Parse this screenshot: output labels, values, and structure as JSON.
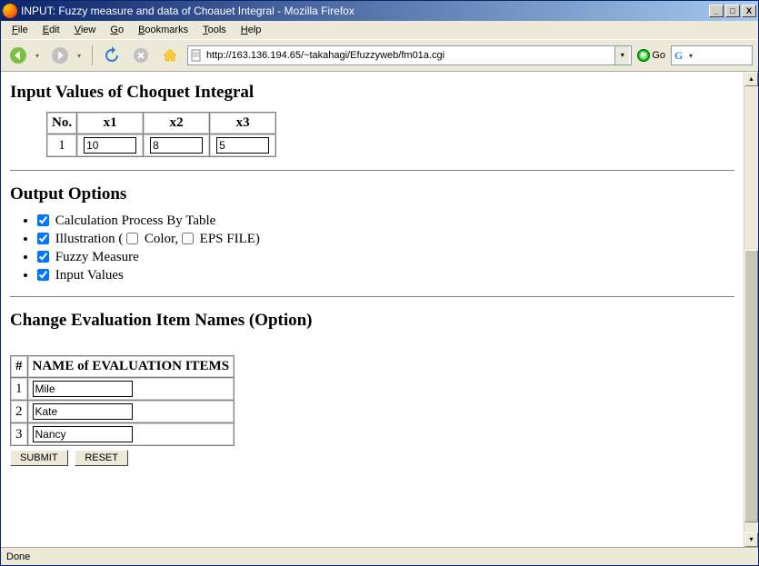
{
  "window": {
    "title": "INPUT: Fuzzy measure and data of Choauet Integral - Mozilla Firefox"
  },
  "menubar": {
    "file": "File",
    "edit": "Edit",
    "view": "View",
    "go": "Go",
    "bookmarks": "Bookmarks",
    "tools": "Tools",
    "help": "Help"
  },
  "toolbar": {
    "url": "http://163.136.194.65/~takahagi/Efuzzyweb/fm01a.cgi",
    "go_label": "Go"
  },
  "page": {
    "section1_heading": "Input Values of Choquet Integral",
    "input_table": {
      "headers": {
        "no": "No.",
        "x1": "x1",
        "x2": "x2",
        "x3": "x3"
      },
      "row1": {
        "no": "1",
        "x1": "10",
        "x2": "8",
        "x3": "5"
      }
    },
    "section2_heading": "Output Options",
    "options": {
      "calc_label": "Calculation Process By Table",
      "illus_label_pre": "Illustration (",
      "color_label": "Color,",
      "eps_label": "EPS FILE)",
      "fuzzy_label": "Fuzzy Measure",
      "inputvals_label": "Input Values"
    },
    "section3_heading": "Change Evaluation Item Names (Option)",
    "eval_table": {
      "hash": "#",
      "name_header": "NAME of EVALUATION ITEMS",
      "r1_no": "1",
      "r1_name": "Mile",
      "r2_no": "2",
      "r2_name": "Kate",
      "r3_no": "3",
      "r3_name": "Nancy"
    },
    "buttons": {
      "submit": "SUBMIT",
      "reset": "RESET"
    }
  },
  "statusbar": {
    "text": "Done"
  }
}
